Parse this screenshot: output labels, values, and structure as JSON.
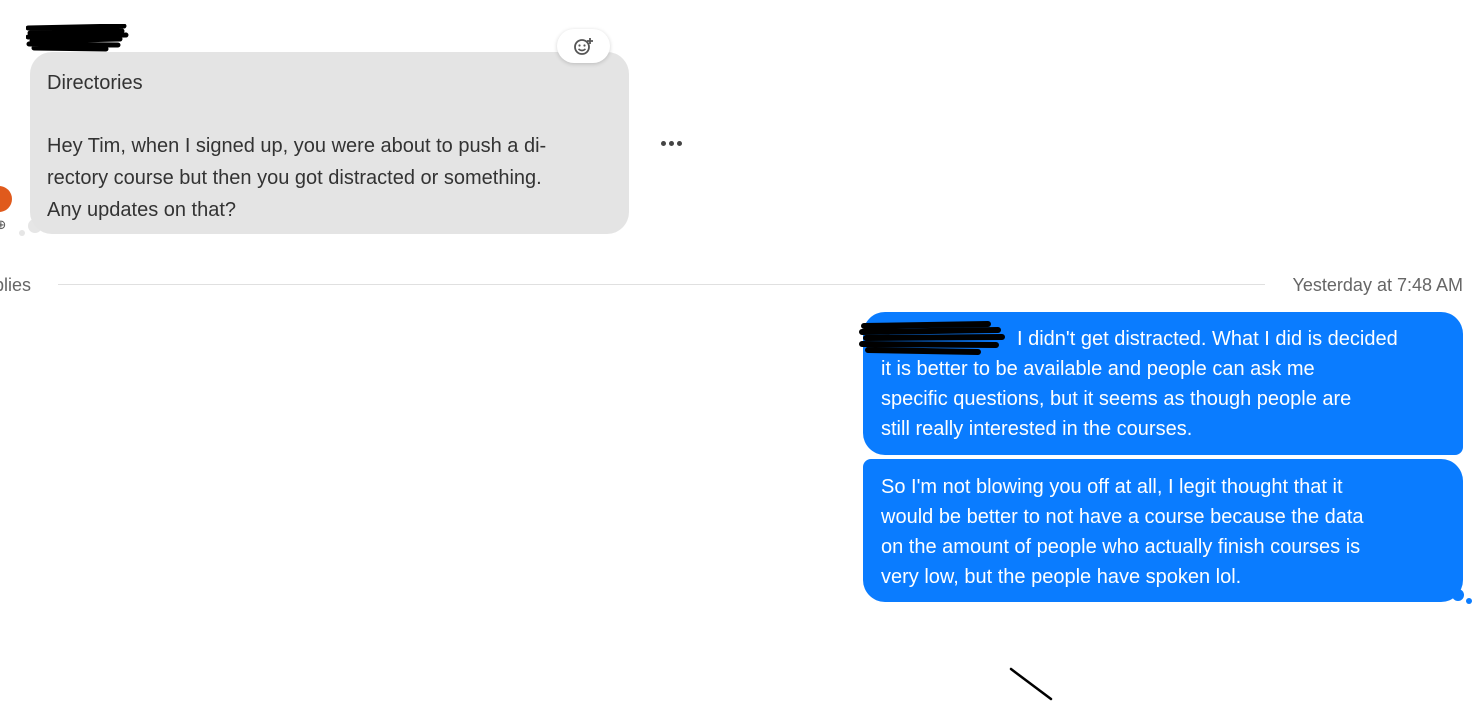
{
  "incoming_message": {
    "subject": "Directories",
    "body": "Hey Tim, when I signed up, you were about to push a di-rectory course but then you got distracted or something. Any updates on that?",
    "lines": [
      "Hey Tim, when I signed up, you were about to push a di-",
      "rectory course but then you got distracted or something.",
      "Any updates on that?"
    ],
    "react_icon": "add-reaction-icon",
    "more_icon": "more-options-icon"
  },
  "thread": {
    "replies_label": "plies",
    "timestamp": "Yesterday at 7:48 AM"
  },
  "outgoing_messages": [
    {
      "lines": [
        "I didn't get distracted. What I did is decided",
        "it is better to be available and people can ask me",
        "specific questions, but it seems as though people are",
        "still really interested in the courses."
      ]
    },
    {
      "lines": [
        "So I'm not blowing you off at all, I legit thought that it",
        "would be better to not have a course because the data",
        "on the amount of people who actually finish courses is",
        "very low, but the people have spoken lol."
      ]
    }
  ],
  "colors": {
    "outgoing_bubble": "#0a7cff",
    "incoming_bubble": "#e4e4e4",
    "background": "#ffffff"
  }
}
